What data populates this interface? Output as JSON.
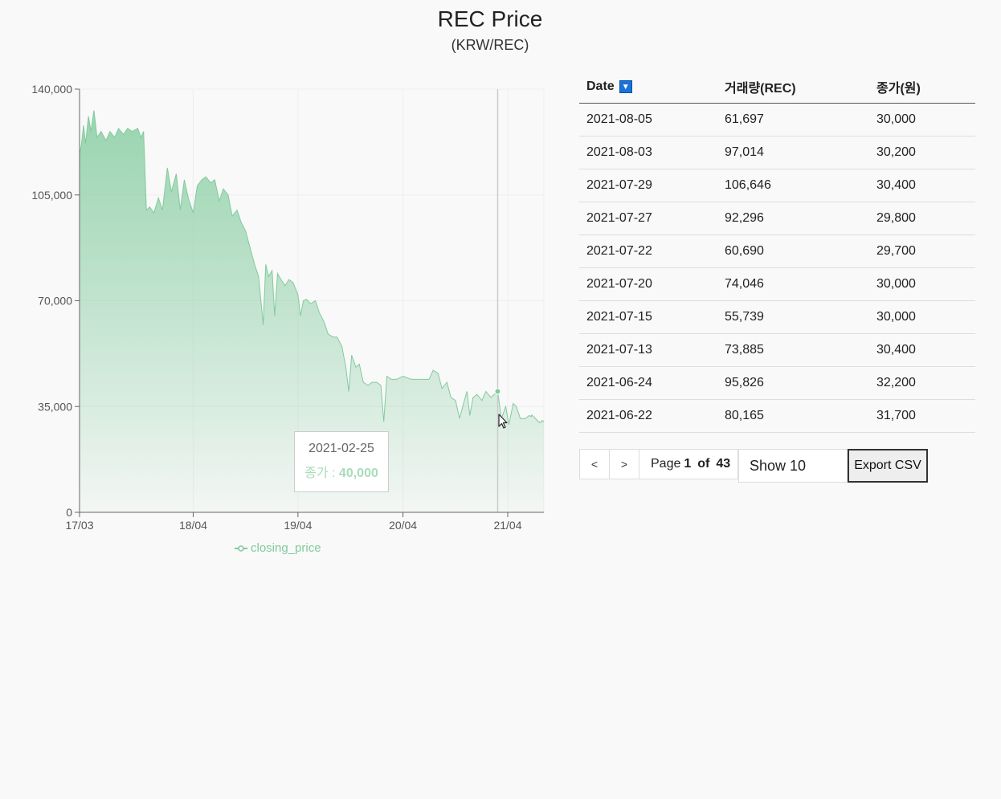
{
  "header": {
    "title": "REC Price",
    "subtitle": "(KRW/REC)"
  },
  "colors": {
    "series": "#82ca9d",
    "series_fill_top": "#8fd0a8",
    "axis": "#666666",
    "sort_button": "#1a73d9"
  },
  "chart_data": {
    "type": "area",
    "series": [
      {
        "name": "closing_price",
        "points": [
          [
            "2017-03-01",
            118000
          ],
          [
            "2017-03-08",
            122000
          ],
          [
            "2017-03-15",
            128000
          ],
          [
            "2017-03-22",
            122000
          ],
          [
            "2017-04-01",
            131000
          ],
          [
            "2017-04-10",
            126000
          ],
          [
            "2017-04-20",
            133000
          ],
          [
            "2017-05-01",
            124000
          ],
          [
            "2017-05-15",
            126000
          ],
          [
            "2017-06-01",
            123000
          ],
          [
            "2017-06-15",
            126000
          ],
          [
            "2017-07-01",
            124000
          ],
          [
            "2017-07-15",
            127000
          ],
          [
            "2017-08-01",
            125000
          ],
          [
            "2017-08-15",
            127000
          ],
          [
            "2017-09-01",
            126000
          ],
          [
            "2017-09-20",
            127000
          ],
          [
            "2017-10-01",
            124000
          ],
          [
            "2017-10-10",
            126000
          ],
          [
            "2017-10-20",
            100000
          ],
          [
            "2017-11-01",
            101000
          ],
          [
            "2017-11-15",
            99000
          ],
          [
            "2017-12-01",
            104000
          ],
          [
            "2017-12-15",
            100000
          ],
          [
            "2018-01-01",
            114000
          ],
          [
            "2018-01-15",
            106000
          ],
          [
            "2018-02-01",
            112000
          ],
          [
            "2018-02-15",
            100000
          ],
          [
            "2018-03-01",
            110000
          ],
          [
            "2018-03-15",
            104000
          ],
          [
            "2018-04-01",
            99000
          ],
          [
            "2018-04-15",
            108000
          ],
          [
            "2018-05-01",
            110000
          ],
          [
            "2018-05-15",
            111000
          ],
          [
            "2018-06-01",
            109000
          ],
          [
            "2018-06-15",
            110000
          ],
          [
            "2018-07-01",
            103000
          ],
          [
            "2018-07-15",
            107000
          ],
          [
            "2018-08-01",
            105000
          ],
          [
            "2018-08-15",
            98000
          ],
          [
            "2018-09-01",
            100000
          ],
          [
            "2018-09-15",
            96000
          ],
          [
            "2018-10-01",
            93000
          ],
          [
            "2018-10-15",
            88000
          ],
          [
            "2018-11-01",
            82000
          ],
          [
            "2018-11-15",
            78000
          ],
          [
            "2018-12-01",
            62000
          ],
          [
            "2018-12-10",
            82000
          ],
          [
            "2018-12-20",
            78000
          ],
          [
            "2019-01-01",
            80000
          ],
          [
            "2019-01-10",
            65000
          ],
          [
            "2019-01-20",
            79000
          ],
          [
            "2019-02-01",
            77000
          ],
          [
            "2019-02-15",
            75000
          ],
          [
            "2019-03-01",
            77000
          ],
          [
            "2019-03-15",
            76000
          ],
          [
            "2019-04-01",
            72000
          ],
          [
            "2019-04-10",
            65000
          ],
          [
            "2019-04-20",
            70000
          ],
          [
            "2019-05-01",
            70500
          ],
          [
            "2019-05-15",
            69000
          ],
          [
            "2019-06-01",
            70000
          ],
          [
            "2019-06-15",
            66000
          ],
          [
            "2019-07-01",
            63000
          ],
          [
            "2019-07-15",
            59000
          ],
          [
            "2019-08-01",
            58000
          ],
          [
            "2019-08-15",
            58000
          ],
          [
            "2019-09-01",
            55000
          ],
          [
            "2019-09-15",
            48000
          ],
          [
            "2019-09-25",
            40000
          ],
          [
            "2019-10-05",
            52000
          ],
          [
            "2019-10-20",
            48000
          ],
          [
            "2019-11-01",
            49000
          ],
          [
            "2019-11-15",
            43000
          ],
          [
            "2019-12-01",
            42000
          ],
          [
            "2019-12-15",
            43000
          ],
          [
            "2020-01-01",
            43000
          ],
          [
            "2020-01-15",
            42000
          ],
          [
            "2020-01-25",
            30000
          ],
          [
            "2020-02-05",
            45000
          ],
          [
            "2020-02-20",
            44000
          ],
          [
            "2020-03-10",
            44000
          ],
          [
            "2020-04-01",
            45000
          ],
          [
            "2020-05-01",
            44000
          ],
          [
            "2020-06-01",
            44000
          ],
          [
            "2020-07-01",
            44000
          ],
          [
            "2020-07-15",
            47000
          ],
          [
            "2020-08-01",
            46000
          ],
          [
            "2020-08-15",
            41000
          ],
          [
            "2020-09-01",
            43000
          ],
          [
            "2020-09-15",
            38000
          ],
          [
            "2020-10-01",
            37000
          ],
          [
            "2020-10-15",
            31000
          ],
          [
            "2020-11-01",
            37000
          ],
          [
            "2020-11-10",
            40000
          ],
          [
            "2020-11-20",
            32000
          ],
          [
            "2020-12-01",
            38000
          ],
          [
            "2020-12-15",
            39000
          ],
          [
            "2021-01-01",
            37000
          ],
          [
            "2021-01-15",
            40000
          ],
          [
            "2021-02-01",
            38000
          ],
          [
            "2021-02-25",
            40000
          ],
          [
            "2021-03-10",
            31000
          ],
          [
            "2021-03-25",
            35000
          ],
          [
            "2021-04-05",
            29000
          ],
          [
            "2021-04-20",
            36000
          ],
          [
            "2021-05-01",
            35000
          ],
          [
            "2021-05-15",
            31000
          ],
          [
            "2021-06-01",
            31000
          ],
          [
            "2021-06-15",
            32000
          ],
          [
            "2021-06-22",
            31700
          ],
          [
            "2021-06-24",
            32200
          ],
          [
            "2021-07-13",
            30400
          ],
          [
            "2021-07-15",
            30000
          ],
          [
            "2021-07-20",
            30000
          ],
          [
            "2021-07-22",
            29700
          ],
          [
            "2021-07-27",
            29800
          ],
          [
            "2021-07-29",
            30400
          ],
          [
            "2021-08-03",
            30200
          ],
          [
            "2021-08-05",
            30000
          ]
        ]
      }
    ],
    "x_ticks": [
      "17/03",
      "18/04",
      "19/04",
      "20/04",
      "21/04"
    ],
    "x_tick_dates": [
      "2017-03-01",
      "2018-04-01",
      "2019-04-01",
      "2020-04-01",
      "2021-04-01"
    ],
    "x_range": [
      "2017-03-01",
      "2021-08-05"
    ],
    "y_ticks": [
      0,
      35000,
      70000,
      105000,
      140000
    ],
    "y_tick_labels": [
      "0",
      "35,000",
      "70,000",
      "105,000",
      "140,000"
    ],
    "ylim": [
      0,
      140000
    ],
    "grid": true,
    "legend_position": "bottom",
    "legend": [
      "closing_price"
    ],
    "active_point": {
      "date": "2021-02-25",
      "value": 40000
    }
  },
  "tooltip": {
    "date": "2021-02-25",
    "label": "종가 : ",
    "value": "40,000"
  },
  "table": {
    "headers": {
      "date": "Date",
      "volume": "거래량(REC)",
      "close": "종가(원)"
    },
    "rows": [
      {
        "date": "2021-08-05",
        "volume": "61,697",
        "close": "30,000"
      },
      {
        "date": "2021-08-03",
        "volume": "97,014",
        "close": "30,200"
      },
      {
        "date": "2021-07-29",
        "volume": "106,646",
        "close": "30,400"
      },
      {
        "date": "2021-07-27",
        "volume": "92,296",
        "close": "29,800"
      },
      {
        "date": "2021-07-22",
        "volume": "60,690",
        "close": "29,700"
      },
      {
        "date": "2021-07-20",
        "volume": "74,046",
        "close": "30,000"
      },
      {
        "date": "2021-07-15",
        "volume": "55,739",
        "close": "30,000"
      },
      {
        "date": "2021-07-13",
        "volume": "73,885",
        "close": "30,400"
      },
      {
        "date": "2021-06-24",
        "volume": "95,826",
        "close": "32,200"
      },
      {
        "date": "2021-06-22",
        "volume": "80,165",
        "close": "31,700"
      }
    ]
  },
  "pagination": {
    "prev_label": "<",
    "next_label": ">",
    "page_word": "Page",
    "current_page": "1",
    "of_word": "of",
    "total_pages": "43",
    "page_size_label": "Show 10",
    "export_label": "Export CSV"
  }
}
